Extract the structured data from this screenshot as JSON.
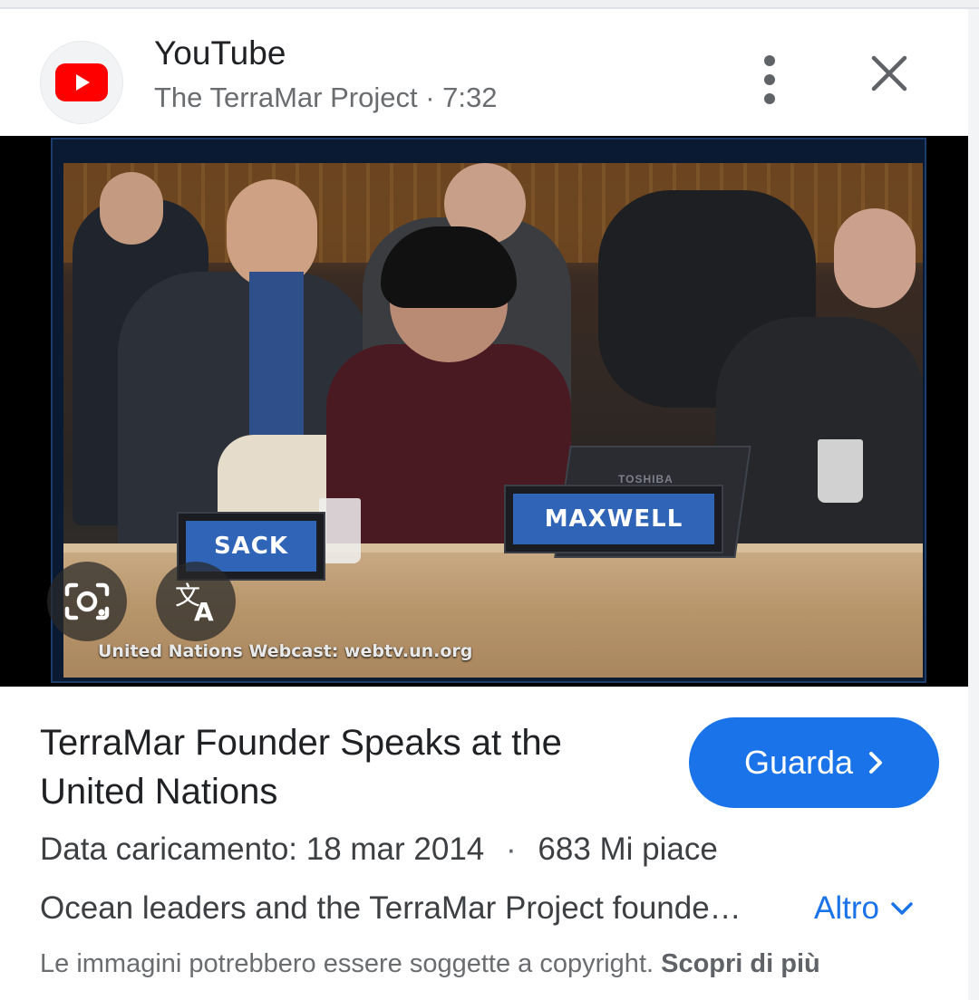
{
  "header": {
    "source_name": "YouTube",
    "channel": "The TerraMar Project",
    "separator": "·",
    "duration": "7:32",
    "icons": {
      "source": "youtube-logo-icon",
      "more": "more-vert-icon",
      "close": "close-icon"
    }
  },
  "media": {
    "nameplates": {
      "left": "SACK",
      "center": "MAXWELL"
    },
    "laptop_brand": "TOSHIBA",
    "watermark": "United Nations Webcast: webtv.un.org",
    "overlay_icons": [
      "lens-search-icon",
      "translate-icon"
    ]
  },
  "video": {
    "title": "TerraMar Founder Speaks at the United Nations",
    "watch_label": "Guarda",
    "upload_label": "Data caricamento: 18 mar 2014",
    "meta_separator": "·",
    "likes": "683 Mi piace",
    "description": "Ocean leaders and the TerraMar Project founde…",
    "more_label": "Altro"
  },
  "footer": {
    "copyright_text": "Le immagini potrebbero essere soggette a copyright.",
    "learn_more": "Scopri di più"
  },
  "colors": {
    "accent": "#1a73e8",
    "youtube_red": "#ff0000",
    "text_primary": "#202124",
    "text_secondary": "#6a6d70"
  }
}
